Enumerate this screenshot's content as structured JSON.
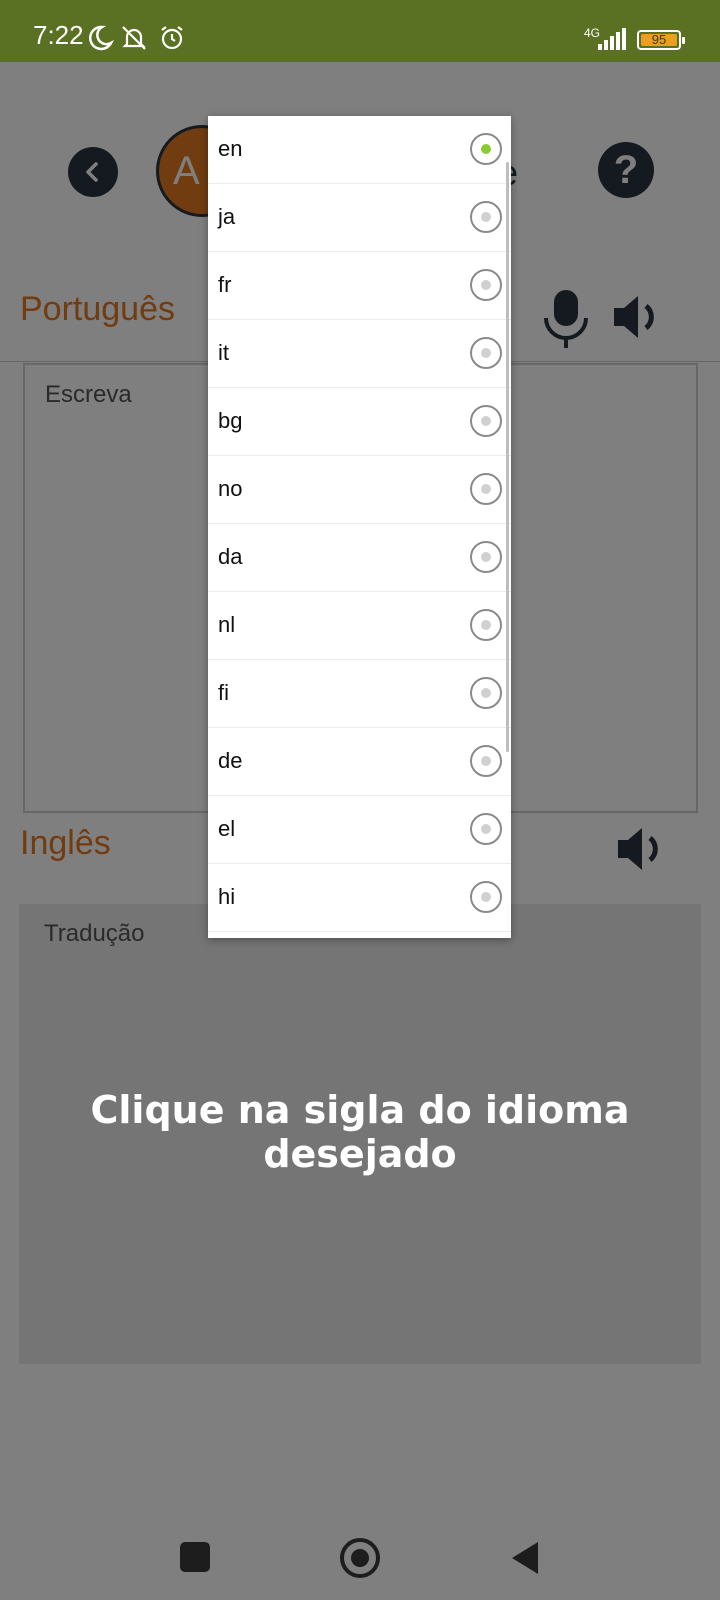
{
  "status_bar": {
    "time": "7:22",
    "network": "4G",
    "battery": "95",
    "icons": [
      "moon-icon",
      "bell-off-icon",
      "alarm-icon",
      "signal-icon",
      "battery-icon"
    ]
  },
  "header": {
    "logo_letter": "A",
    "title_fragment": "e",
    "icons": [
      "back-icon",
      "help-icon"
    ]
  },
  "source": {
    "language_label": "Português",
    "placeholder": "Escreva"
  },
  "target": {
    "language_label": "Inglês",
    "placeholder": "Tradução"
  },
  "instruction": "Clique na sigla do idioma desejado",
  "dropdown": {
    "selected": "en",
    "items": [
      {
        "code": "en",
        "checked": true
      },
      {
        "code": "ja",
        "checked": false
      },
      {
        "code": "fr",
        "checked": false
      },
      {
        "code": "it",
        "checked": false
      },
      {
        "code": "bg",
        "checked": false
      },
      {
        "code": "no",
        "checked": false
      },
      {
        "code": "da",
        "checked": false
      },
      {
        "code": "nl",
        "checked": false
      },
      {
        "code": "fi",
        "checked": false
      },
      {
        "code": "de",
        "checked": false
      },
      {
        "code": "el",
        "checked": false
      },
      {
        "code": "hi",
        "checked": false
      }
    ]
  },
  "colors": {
    "status_bar": "#5a7022",
    "accent": "#e07820",
    "dark": "#2b3540",
    "radio_checked": "#8ccc33"
  }
}
